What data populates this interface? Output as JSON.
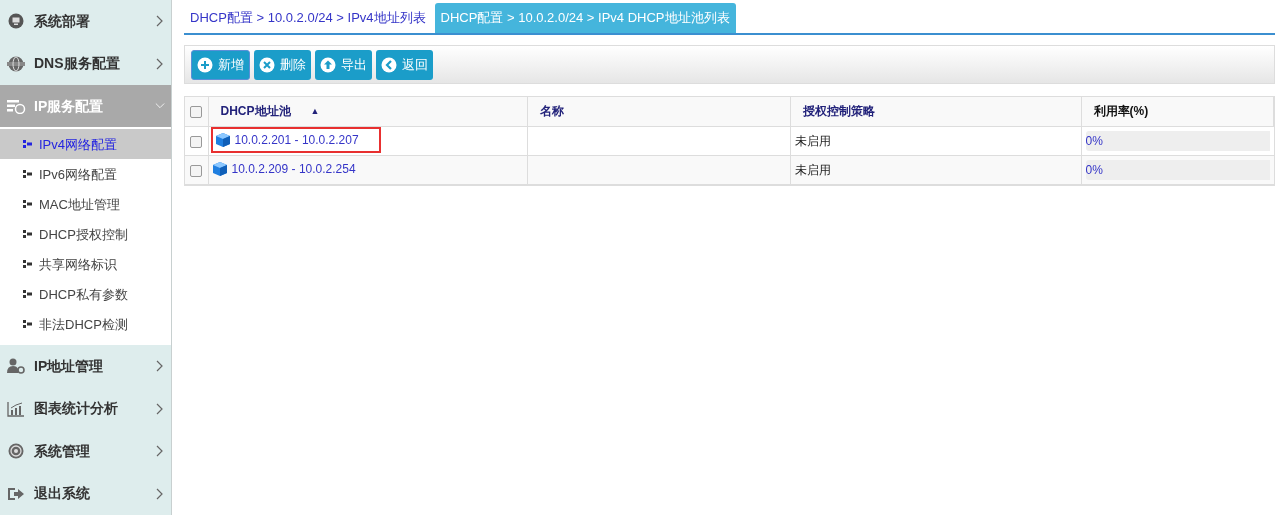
{
  "sidebar": {
    "items": [
      {
        "label": "系统部署",
        "expanded": false
      },
      {
        "label": "DNS服务配置",
        "expanded": false
      },
      {
        "label": "IP服务配置",
        "expanded": true,
        "children": [
          {
            "label": "IPv4网络配置",
            "selected": true
          },
          {
            "label": "IPv6网络配置",
            "selected": false
          },
          {
            "label": "MAC地址管理",
            "selected": false
          },
          {
            "label": "DHCP授权控制",
            "selected": false
          },
          {
            "label": "共享网络标识",
            "selected": false
          },
          {
            "label": "DHCP私有参数",
            "selected": false
          },
          {
            "label": "非法DHCP检测",
            "selected": false
          }
        ]
      },
      {
        "label": "IP地址管理",
        "expanded": false
      },
      {
        "label": "图表统计分析",
        "expanded": false
      },
      {
        "label": "系统管理",
        "expanded": false
      },
      {
        "label": "退出系统",
        "expanded": false
      }
    ]
  },
  "tabs": [
    {
      "label": "DHCP配置 > 10.0.2.0/24 > IPv4地址列表",
      "selected": false
    },
    {
      "label": "DHCP配置 > 10.0.2.0/24 > IPv4 DHCP地址池列表",
      "selected": true
    }
  ],
  "toolbar": [
    {
      "kind": "add",
      "label": "新增"
    },
    {
      "kind": "delete",
      "label": "删除"
    },
    {
      "kind": "export",
      "label": "导出"
    },
    {
      "kind": "back",
      "label": "返回"
    }
  ],
  "table": {
    "all_checked": false,
    "columns": [
      {
        "label": "DHCP地址池",
        "sort": "▲"
      },
      {
        "label": "名称"
      },
      {
        "label": "授权控制策略"
      },
      {
        "label": "利用率(%)"
      }
    ],
    "rows": [
      {
        "checked": false,
        "highlighted": true,
        "pool": "10.0.2.201 - 10.0.2.207",
        "policy": "未启用",
        "usage": "0%",
        "level": 0
      },
      {
        "checked": false,
        "highlighted": false,
        "pool": "10.0.2.209 - 10.0.2.254",
        "policy": "未启用",
        "usage": "0%",
        "level": 0
      }
    ]
  }
}
